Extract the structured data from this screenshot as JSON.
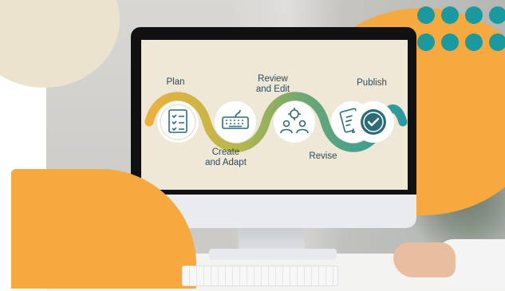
{
  "colors": {
    "accent_orange": "#f6a93e",
    "accent_teal": "#1a9aa0",
    "screen_bg": "#efe8d6",
    "node_fill": "#2d6b78",
    "text_dark": "#2d4a5a"
  },
  "workflow": {
    "steps": [
      {
        "label": "Plan",
        "icon": "checklist-icon"
      },
      {
        "label_line1": "Create",
        "label_line2": "and Adapt",
        "icon": "keyboard-icon"
      },
      {
        "label_line1": "Review",
        "label_line2": "and Edit",
        "icon": "team-gear-icon"
      },
      {
        "label": "Revise",
        "icon": "clipboard-pencil-icon"
      },
      {
        "label": "Publish",
        "icon": "checkmark-circle-icon"
      }
    ]
  }
}
